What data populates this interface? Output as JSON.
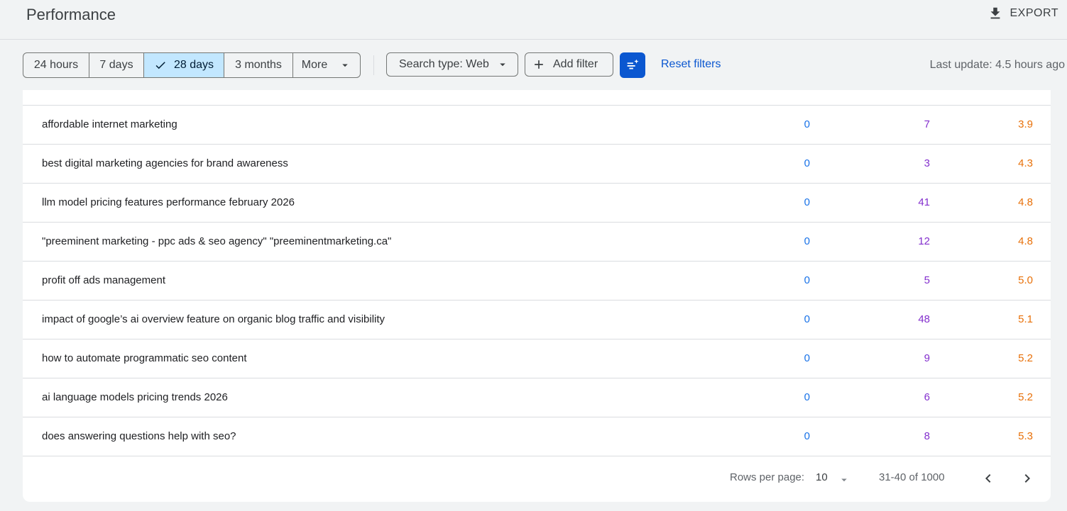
{
  "header": {
    "title": "Performance",
    "export_label": "EXPORT"
  },
  "toolbar": {
    "date_ranges": [
      {
        "label": "24 hours"
      },
      {
        "label": "7 days"
      },
      {
        "label": "28 days",
        "selected": true
      },
      {
        "label": "3 months"
      },
      {
        "label": "More"
      }
    ],
    "search_type_label": "Search type: Web",
    "add_filter_label": "Add filter",
    "reset_filters_label": "Reset filters",
    "last_update": "Last update: 4.5 hours ago"
  },
  "table": {
    "rows": [
      {
        "query": "affordable internet marketing",
        "clicks": "0",
        "impressions": "7",
        "position": "3.9"
      },
      {
        "query": "best digital marketing agencies for brand awareness",
        "clicks": "0",
        "impressions": "3",
        "position": "4.3"
      },
      {
        "query": "llm model pricing features performance february 2026",
        "clicks": "0",
        "impressions": "41",
        "position": "4.8"
      },
      {
        "query": "\"preeminent marketing - ppc ads & seo agency\" \"preeminentmarketing.ca\"",
        "clicks": "0",
        "impressions": "12",
        "position": "4.8"
      },
      {
        "query": "profit off ads management",
        "clicks": "0",
        "impressions": "5",
        "position": "5.0"
      },
      {
        "query": "impact of google’s ai overview feature on organic blog traffic and visibility",
        "clicks": "0",
        "impressions": "48",
        "position": "5.1"
      },
      {
        "query": "how to automate programmatic seo content",
        "clicks": "0",
        "impressions": "9",
        "position": "5.2"
      },
      {
        "query": "ai language models pricing trends 2026",
        "clicks": "0",
        "impressions": "6",
        "position": "5.2"
      },
      {
        "query": "does answering questions help with seo?",
        "clicks": "0",
        "impressions": "8",
        "position": "5.3"
      }
    ]
  },
  "pagination": {
    "rows_per_page_label": "Rows per page:",
    "rows_per_page_value": "10",
    "range_label": "31-40 of 1000"
  },
  "colors": {
    "accent": "#0b57d0",
    "selected_chip": "#c2e7ff",
    "clicks": "#1a73e8",
    "impressions": "#8430ce",
    "position": "#e8710a"
  }
}
